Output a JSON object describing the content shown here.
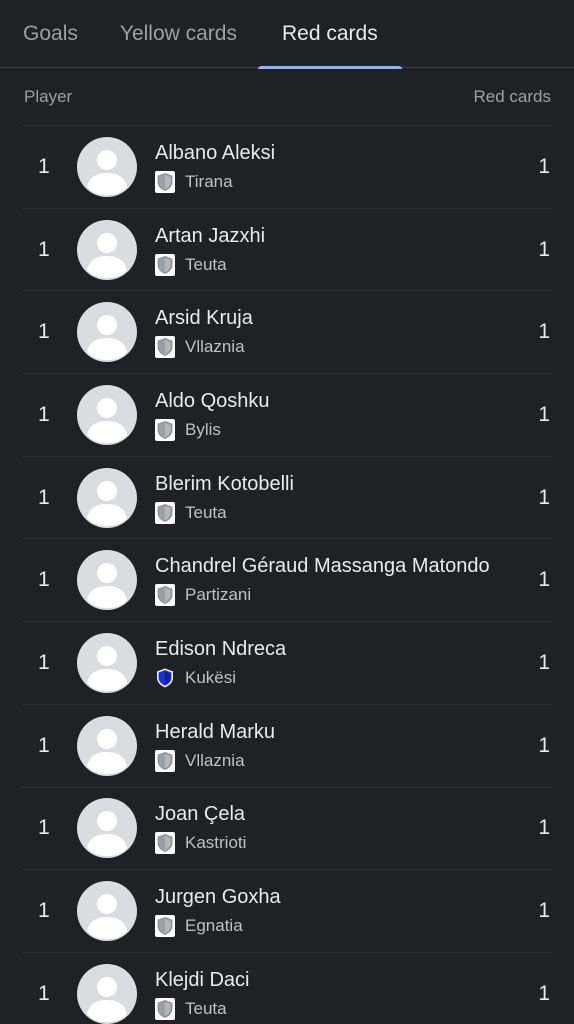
{
  "tabs": [
    {
      "label": "Goals",
      "active": false
    },
    {
      "label": "Yellow cards",
      "active": false
    },
    {
      "label": "Red cards",
      "active": true
    }
  ],
  "table": {
    "col_player": "Player",
    "col_stat": "Red cards",
    "rows": [
      {
        "rank": "1",
        "name": "Albano Aleksi",
        "team": "Tirana",
        "crest": "shield-grey-icon",
        "value": "1"
      },
      {
        "rank": "1",
        "name": "Artan Jazxhi",
        "team": "Teuta",
        "crest": "shield-grey-icon",
        "value": "1"
      },
      {
        "rank": "1",
        "name": "Arsid Kruja",
        "team": "Vllaznia",
        "crest": "shield-grey-icon",
        "value": "1"
      },
      {
        "rank": "1",
        "name": "Aldo Qoshku",
        "team": "Bylis",
        "crest": "shield-grey-icon",
        "value": "1"
      },
      {
        "rank": "1",
        "name": "Blerim Kotobelli",
        "team": "Teuta",
        "crest": "shield-grey-icon",
        "value": "1"
      },
      {
        "rank": "1",
        "name": "Chandrel Géraud Massanga Matondo",
        "team": "Partizani",
        "crest": "shield-grey-icon",
        "value": "1"
      },
      {
        "rank": "1",
        "name": "Edison Ndreca",
        "team": "Kukësi",
        "crest": "shield-blue-icon",
        "value": "1"
      },
      {
        "rank": "1",
        "name": "Herald Marku",
        "team": "Vllaznia",
        "crest": "shield-grey-icon",
        "value": "1"
      },
      {
        "rank": "1",
        "name": "Joan Çela",
        "team": "Kastrioti",
        "crest": "shield-grey-icon",
        "value": "1"
      },
      {
        "rank": "1",
        "name": "Jurgen Goxha",
        "team": "Egnatia",
        "crest": "shield-grey-icon",
        "value": "1"
      },
      {
        "rank": "1",
        "name": "Klejdi Daci",
        "team": "Teuta",
        "crest": "shield-grey-icon",
        "value": "1"
      }
    ]
  },
  "colors": {
    "background": "#202124",
    "accent": "#8ab4f8",
    "kukesi_blue": "#1a3cff"
  }
}
